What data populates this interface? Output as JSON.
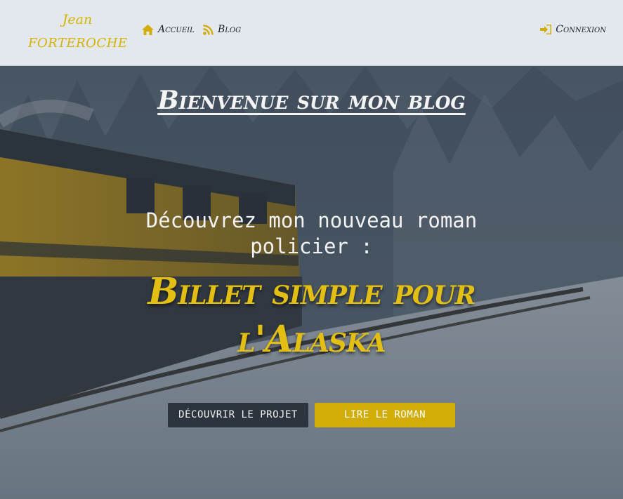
{
  "brand": {
    "first_name": "Jean",
    "last_name": "FORTEROCHE"
  },
  "nav": {
    "home_label": "Accueil",
    "blog_label": "Blog",
    "login_label": "Connexion",
    "home_icon": "home-icon",
    "blog_icon": "rss-icon",
    "login_icon": "sign-in-icon"
  },
  "hero": {
    "title": "Bienvenue sur mon blog",
    "intro": "Découvrez mon nouveau roman policier :",
    "novel_title": "Billet simple pour l'Alaska",
    "background": "train-in-snow-forest-image"
  },
  "buttons": {
    "project_label": "DÉCOUVRIR LE PROJET",
    "read_label": "LIRE LE ROMAN"
  },
  "colors": {
    "accent": "#d3ad07",
    "navbar_bg": "#e3e8ee",
    "dark_button": "#2c343e"
  }
}
